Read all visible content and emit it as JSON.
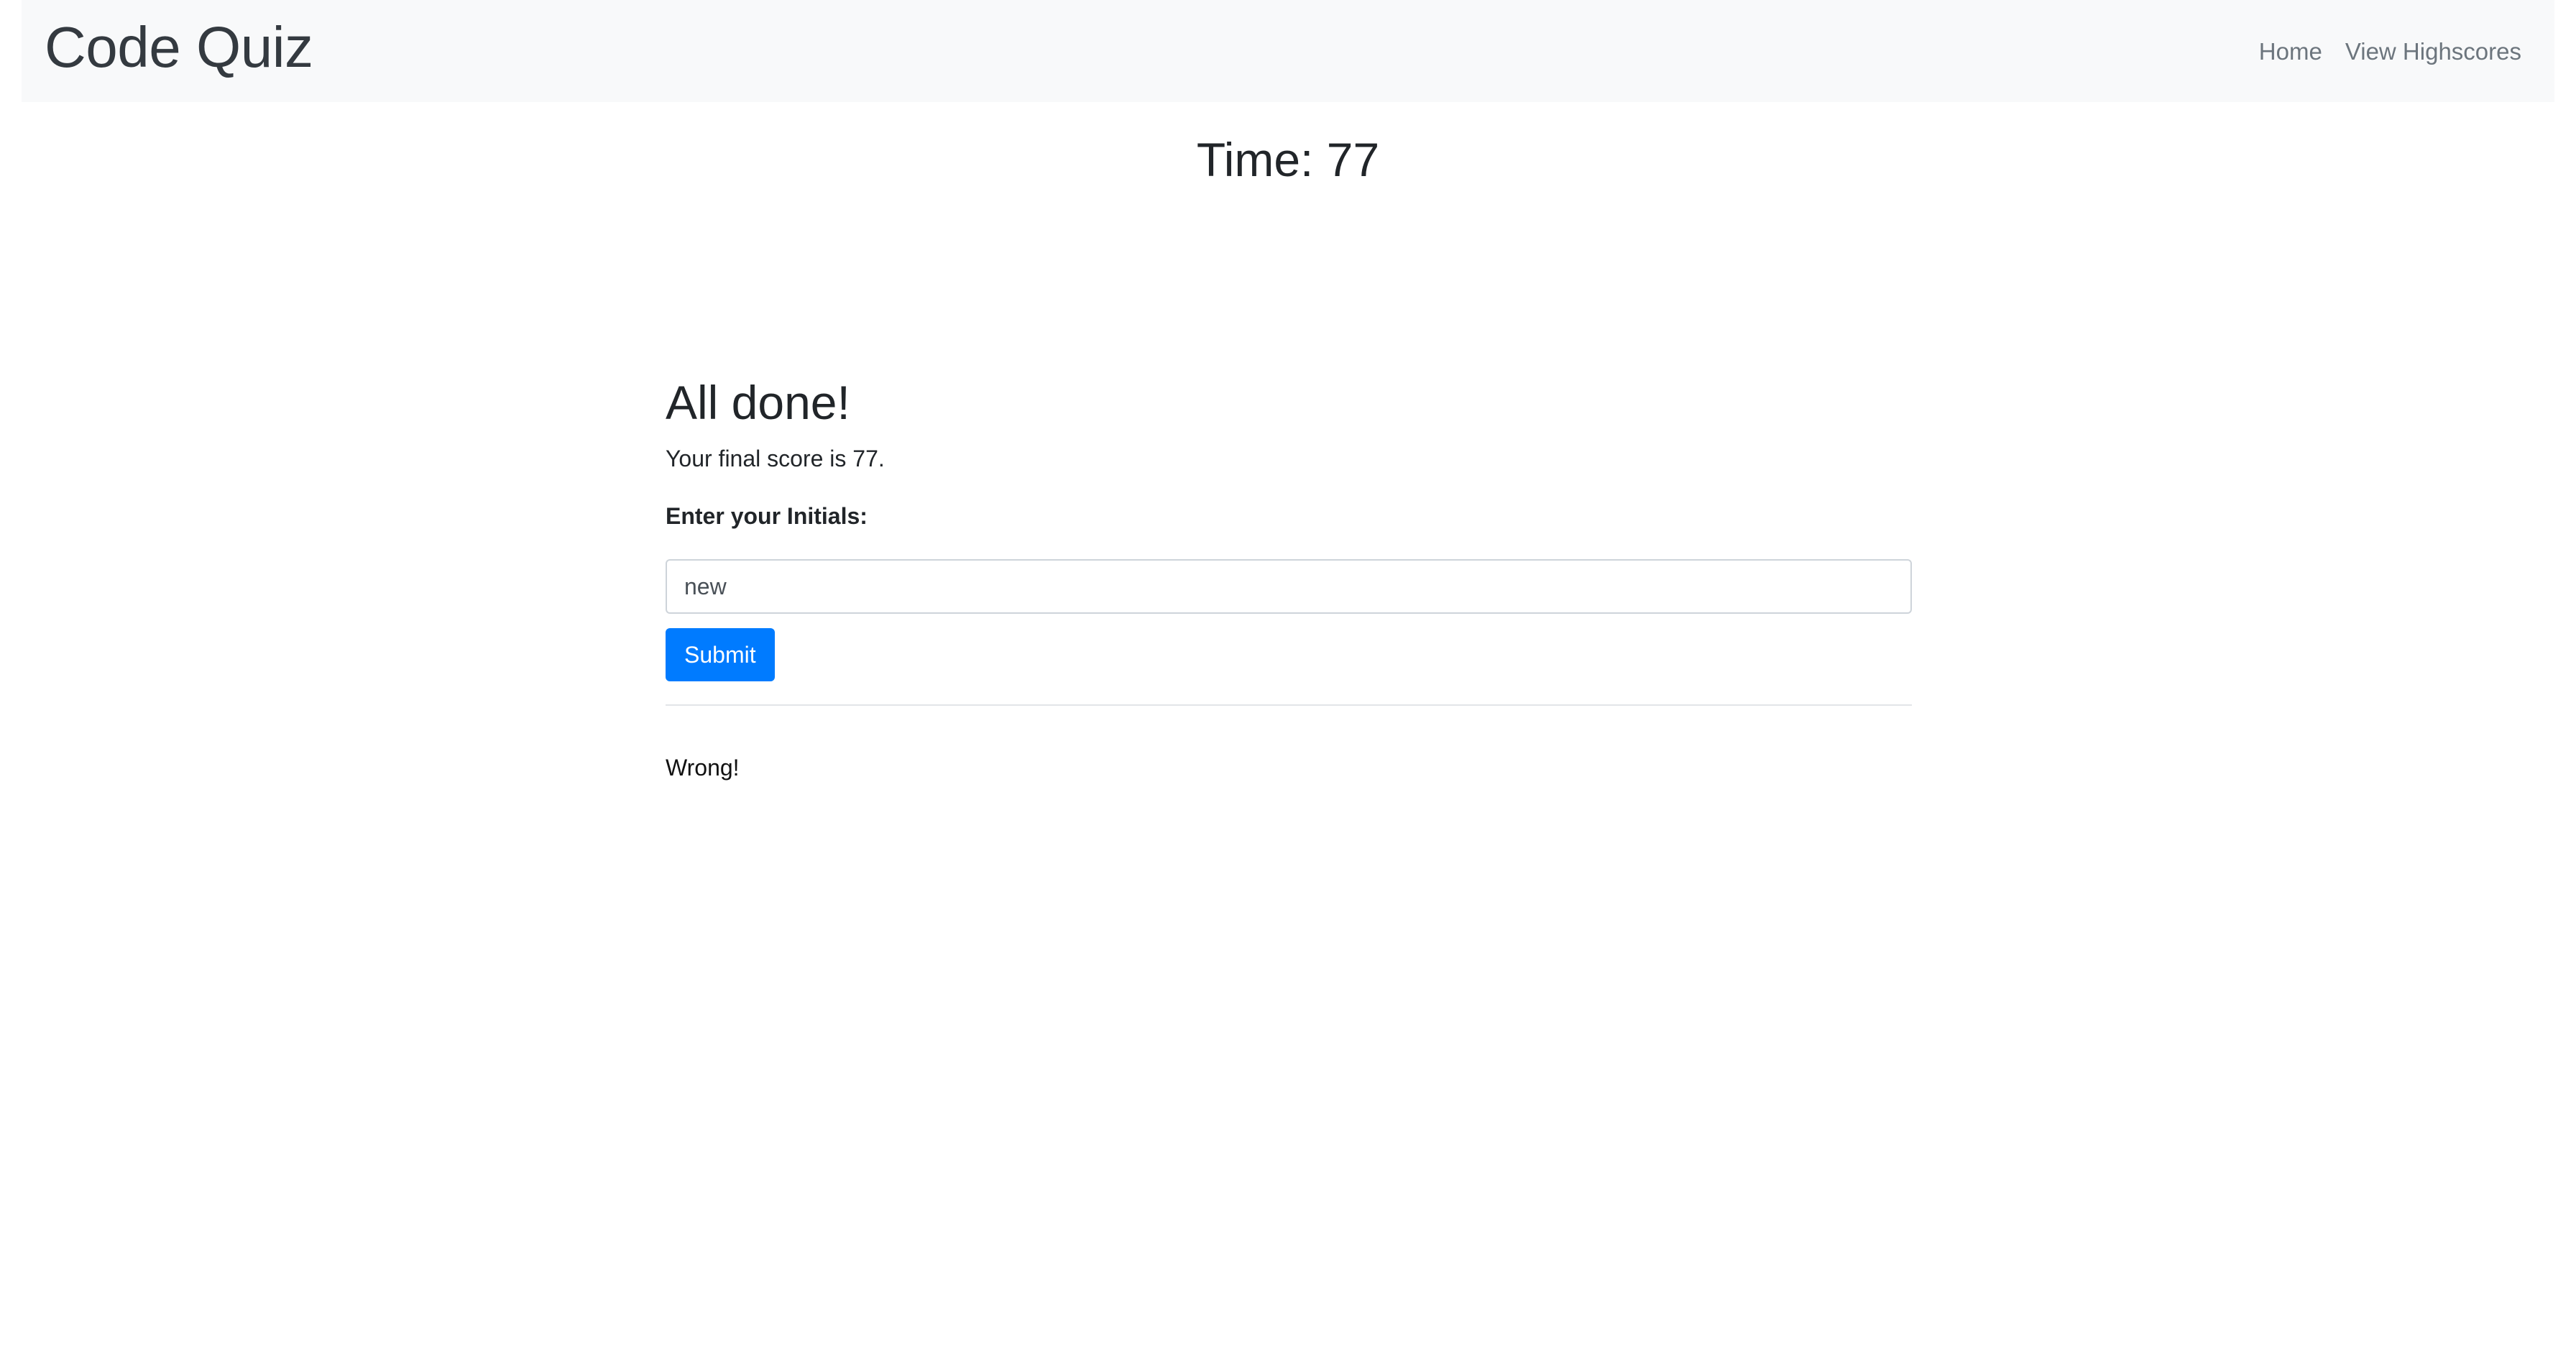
{
  "navbar": {
    "brand": "Code Quiz",
    "links": [
      {
        "label": "Home"
      },
      {
        "label": "View Highscores"
      }
    ]
  },
  "timer": {
    "text": "Time: 77"
  },
  "result": {
    "heading": "All done!",
    "score_text": "Your final score is 77.",
    "initials_label": "Enter your Initials:",
    "initials_value": "new",
    "submit_label": "Submit",
    "feedback": "Wrong!"
  },
  "colors": {
    "navbar_bg": "#f8f9fa",
    "brand": "#343a40",
    "nav_link": "#6c757d",
    "primary": "#007bff",
    "text": "#212529"
  }
}
